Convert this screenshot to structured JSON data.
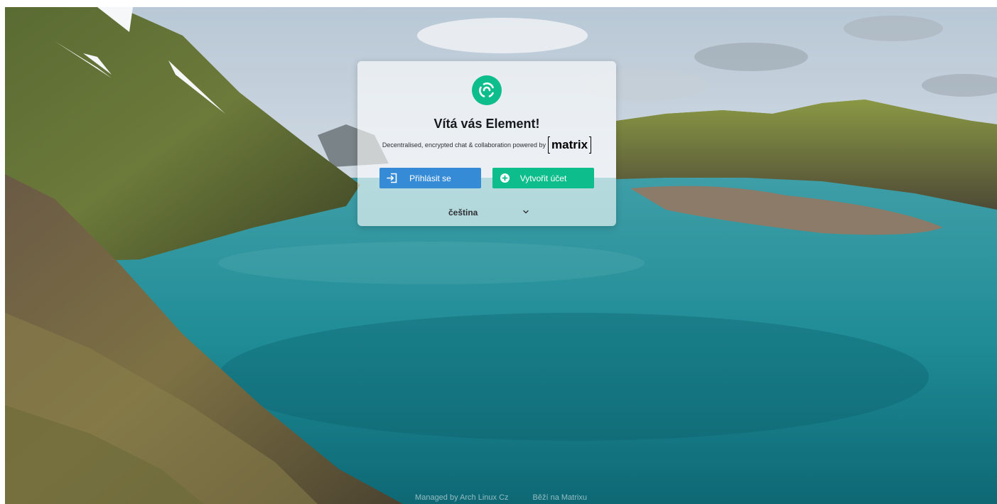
{
  "welcome": {
    "title": "Vítá vás Element!",
    "tagline": "Decentralised, encrypted chat & collaboration powered by",
    "matrix_logo_text": "matrix"
  },
  "buttons": {
    "sign_in": "Přihlásit se",
    "sign_in_icon": "sign-in-icon",
    "register": "Vytvořit účet",
    "register_icon": "plus-circle-icon"
  },
  "language": {
    "selected": "čeština",
    "icon": "chevron-down-icon"
  },
  "footer": {
    "managed_by": "Managed by Arch Linux Cz",
    "powered": "Běží na Matrixu"
  },
  "colors": {
    "sign_in": "#368bd6",
    "register": "#0dbd8b",
    "logo": "#0dbd8b"
  }
}
